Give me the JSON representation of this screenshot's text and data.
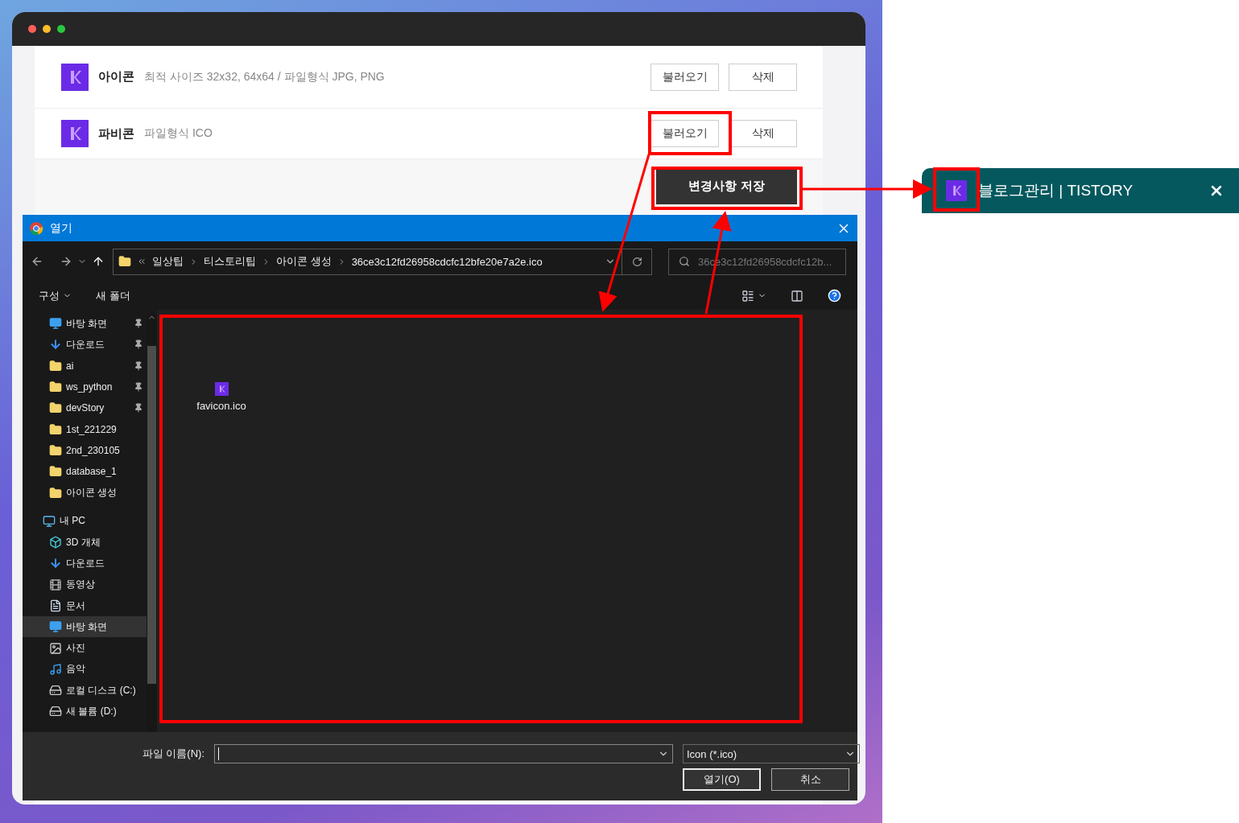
{
  "browser_window": {
    "settings_rows": [
      {
        "title": "아이콘",
        "description": "최적 사이즈 32x32, 64x64 / 파일형식 JPG, PNG",
        "load_button": "불러오기",
        "delete_button": "삭제"
      },
      {
        "title": "파비콘",
        "description": "파일형식 ICO",
        "load_button": "불러오기",
        "delete_button": "삭제"
      }
    ],
    "save_button": "변경사항 저장"
  },
  "open_dialog": {
    "title": "열기",
    "breadcrumb": [
      "일상팁",
      "티스토리팁",
      "아이콘 생성",
      "36ce3c12fd26958cdcfc12bfe20e7a2e.ico"
    ],
    "search_placeholder": "36ce3c12fd26958cdcfc12b...",
    "toolbar": [
      "구성",
      "새 폴더"
    ],
    "sidebar": [
      {
        "label": "바탕 화면",
        "kind": "desktop",
        "pinned": true,
        "selected": false
      },
      {
        "label": "다운로드",
        "kind": "download",
        "pinned": true,
        "selected": false
      },
      {
        "label": "ai",
        "kind": "folder",
        "pinned": true,
        "selected": false
      },
      {
        "label": "ws_python",
        "kind": "folder",
        "pinned": true,
        "selected": false
      },
      {
        "label": "devStory",
        "kind": "folder",
        "pinned": true,
        "selected": false
      },
      {
        "label": "1st_221229",
        "kind": "folder",
        "pinned": false,
        "selected": false
      },
      {
        "label": "2nd_230105",
        "kind": "folder",
        "pinned": false,
        "selected": false
      },
      {
        "label": "database_1",
        "kind": "folder",
        "pinned": false,
        "selected": false
      },
      {
        "label": "아이콘 생성",
        "kind": "folder",
        "pinned": false,
        "selected": false
      },
      {
        "label": "내 PC",
        "kind": "pc",
        "selected": false,
        "children": [
          {
            "label": "3D 개체",
            "kind": "cube",
            "selected": false
          },
          {
            "label": "다운로드",
            "kind": "download",
            "selected": false
          },
          {
            "label": "동영상",
            "kind": "video",
            "selected": false
          },
          {
            "label": "문서",
            "kind": "document",
            "selected": false
          },
          {
            "label": "바탕 화면",
            "kind": "desktop",
            "selected": true
          },
          {
            "label": "사진",
            "kind": "picture",
            "selected": false
          },
          {
            "label": "음악",
            "kind": "music",
            "selected": false
          },
          {
            "label": "로컬 디스크 (C:)",
            "kind": "drive",
            "selected": false
          },
          {
            "label": "새 볼륨 (D:)",
            "kind": "drive",
            "selected": false
          }
        ]
      }
    ],
    "files": [
      {
        "name": "favicon.ico"
      }
    ],
    "file_name_label": "파일 이름(N):",
    "file_type": "Icon (*.ico)",
    "open_button": "열기(O)",
    "cancel_button": "취소"
  },
  "browser_tab": {
    "title": "블로그관리 | TISTORY"
  }
}
